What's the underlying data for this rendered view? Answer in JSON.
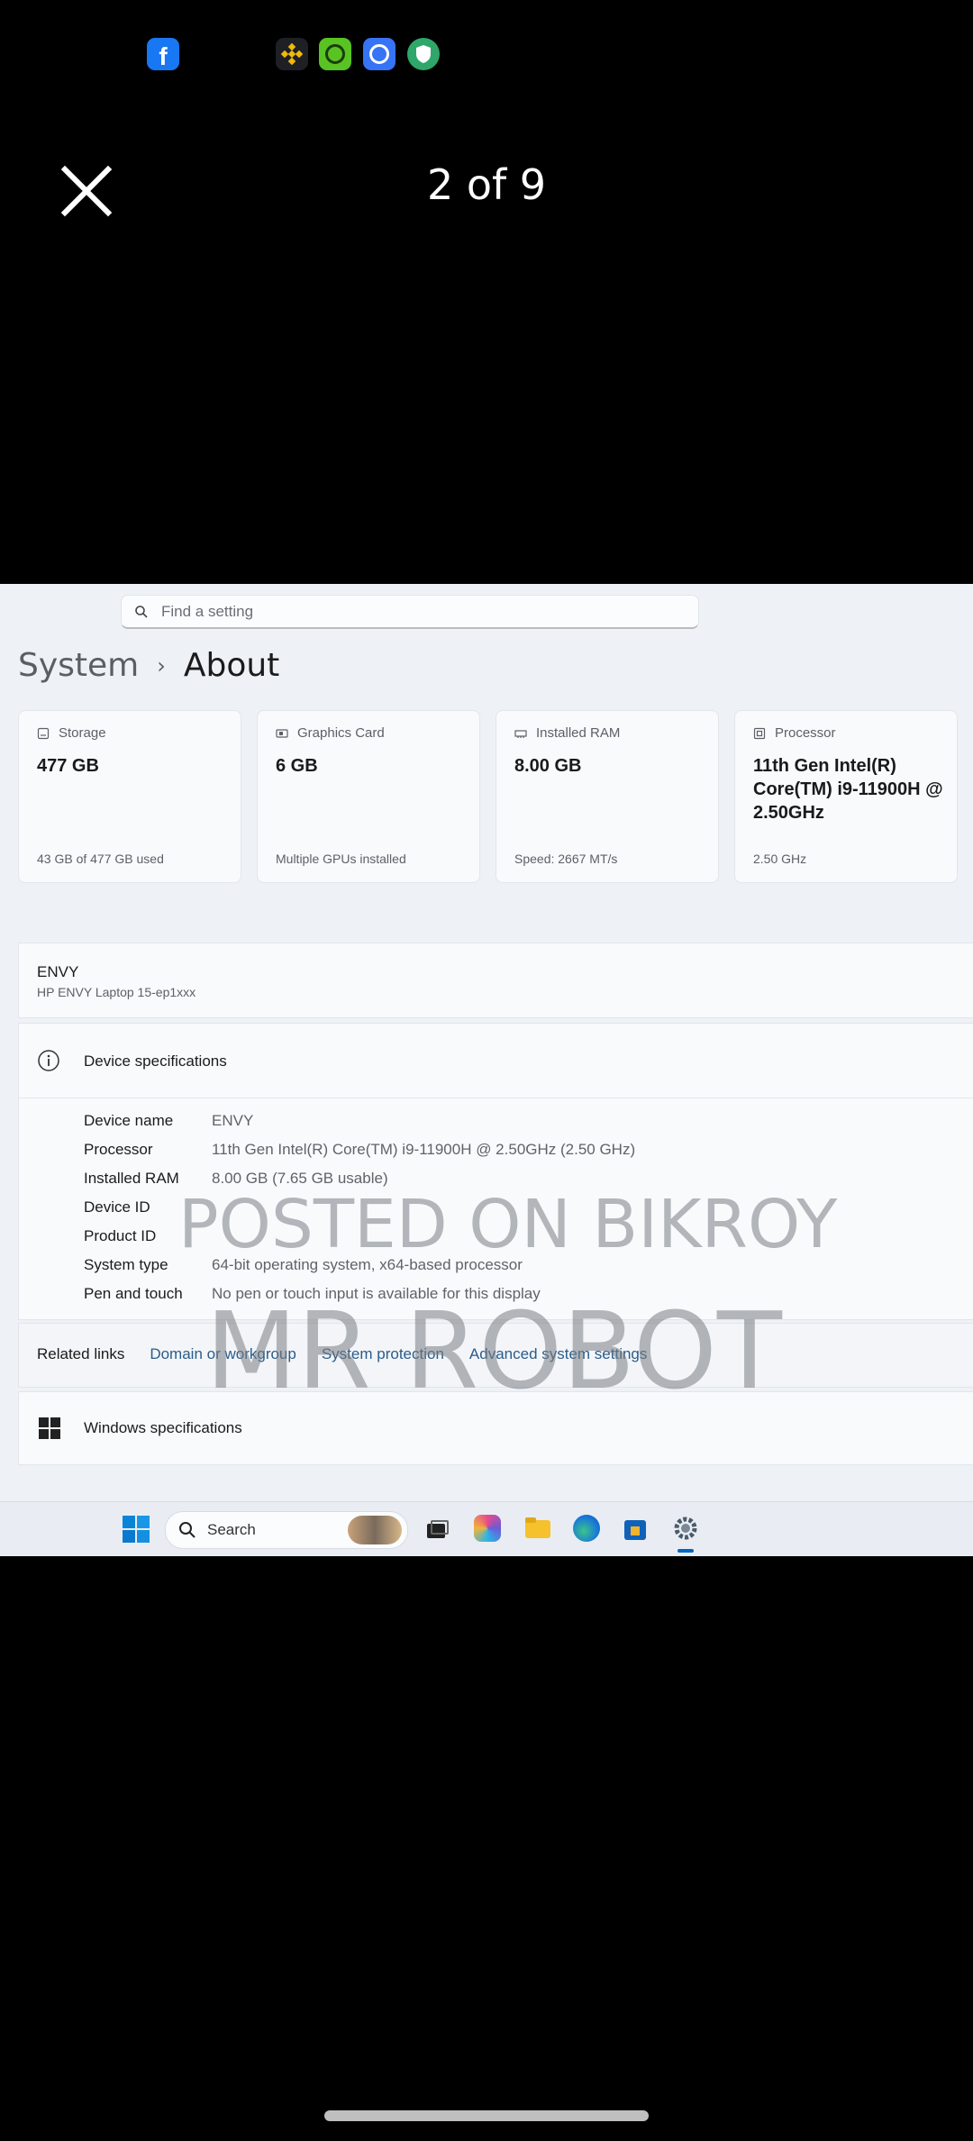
{
  "viewer": {
    "counter": "2 of 9"
  },
  "status_icons": [
    "facebook-icon",
    "binance-icon",
    "green-app-icon",
    "blue-app-icon",
    "shield-app-icon"
  ],
  "settings": {
    "search_placeholder": "Find a setting",
    "breadcrumb": {
      "parent": "System",
      "separator": "›",
      "current": "About"
    },
    "cards": [
      {
        "title": "Storage",
        "value": "477 GB",
        "sub": "43 GB of 477 GB used",
        "icon": "storage-icon"
      },
      {
        "title": "Graphics Card",
        "value": "6 GB",
        "sub": "Multiple GPUs installed",
        "icon": "graphics-card-icon"
      },
      {
        "title": "Installed RAM",
        "value": "8.00 GB",
        "sub": "Speed: 2667 MT/s",
        "icon": "ram-icon"
      },
      {
        "title": "Processor",
        "value": "11th Gen Intel(R) Core(TM) i9-11900H @ 2.50GHz",
        "sub": "2.50 GHz",
        "icon": "processor-icon"
      }
    ],
    "device": {
      "name": "ENVY",
      "model": "HP ENVY Laptop 15-ep1xxx"
    },
    "device_specs": {
      "title": "Device specifications",
      "rows": [
        {
          "key": "Device name",
          "value": "ENVY"
        },
        {
          "key": "Processor",
          "value": "11th Gen Intel(R) Core(TM) i9-11900H @ 2.50GHz (2.50 GHz)"
        },
        {
          "key": "Installed RAM",
          "value": "8.00 GB (7.65 GB usable)"
        },
        {
          "key": "Device ID",
          "value": ""
        },
        {
          "key": "Product ID",
          "value": ""
        },
        {
          "key": "System type",
          "value": "64-bit operating system, x64-based processor"
        },
        {
          "key": "Pen and touch",
          "value": "No pen or touch input is available for this display"
        }
      ]
    },
    "related": {
      "label": "Related links",
      "links": [
        "Domain or workgroup",
        "System protection",
        "Advanced system settings"
      ]
    },
    "windows_specs": "Windows specifications",
    "taskbar": {
      "search_label": "Search"
    }
  },
  "watermark": {
    "line1": "POSTED ON BIKROY",
    "line2": "MR ROBOT"
  },
  "colors": {
    "link": "#2a5c8a",
    "settings_bg": "#eef1f6",
    "accent": "#0067c0"
  }
}
